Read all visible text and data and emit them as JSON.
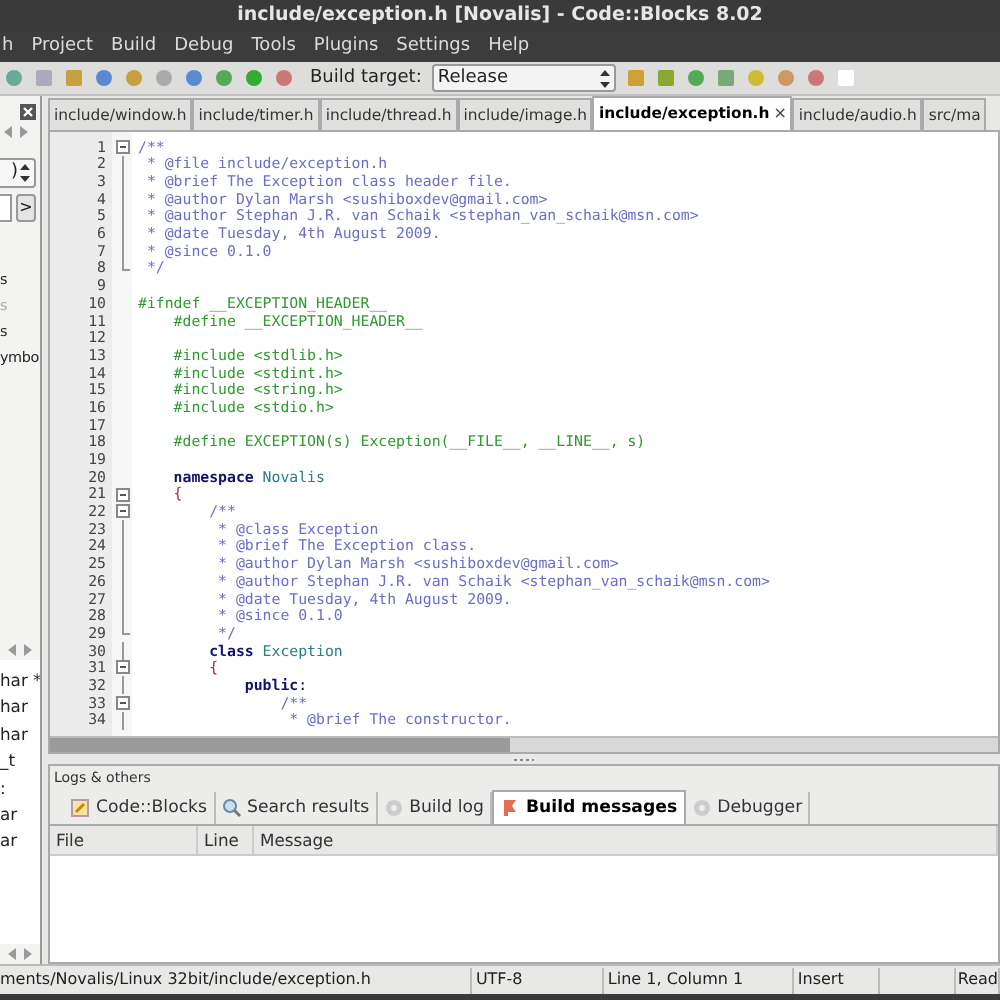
{
  "window": {
    "title": "include/exception.h [Novalis] - Code::Blocks 8.02"
  },
  "menu": [
    "h",
    "Project",
    "Build",
    "Debug",
    "Tools",
    "Plugins",
    "Settings",
    "Help"
  ],
  "toolbar": {
    "build_target_label": "Build target:",
    "build_target_value": "Release"
  },
  "left_panel": {
    "dropdown_value": ")",
    "go_button": ">",
    "items": [
      {
        "text": "s",
        "disabled": false
      },
      {
        "text": "s",
        "disabled": true
      },
      {
        "text": "s",
        "disabled": false
      },
      {
        "text": "ymbo",
        "disabled": false
      }
    ],
    "symbols": [
      "har *",
      "har",
      "har",
      "_t",
      ":",
      "ar",
      "ar"
    ]
  },
  "editor_tabs": [
    {
      "label": "include/window.h",
      "selected": false
    },
    {
      "label": "include/timer.h",
      "selected": false
    },
    {
      "label": "include/thread.h",
      "selected": false
    },
    {
      "label": "include/image.h",
      "selected": false
    },
    {
      "label": "include/exception.h",
      "selected": true,
      "close": "×"
    },
    {
      "label": "include/audio.h",
      "selected": false
    },
    {
      "label": "src/ma",
      "selected": false
    }
  ],
  "editor": {
    "lines": [
      {
        "number": "1",
        "kind": "fold-start",
        "expanded": true,
        "segments": [
          {
            "kind": "comment",
            "text": "/**"
          }
        ]
      },
      {
        "number": "2",
        "kind": "fold-middle",
        "segments": [
          {
            "kind": "comment",
            "text": " * @file include/exception.h"
          }
        ]
      },
      {
        "number": "3",
        "kind": "fold-middle",
        "segments": [
          {
            "kind": "comment",
            "text": " * @brief The Exception class header file."
          }
        ]
      },
      {
        "number": "4",
        "kind": "fold-middle",
        "segments": [
          {
            "kind": "comment",
            "text": " * @author Dylan Marsh <sushiboxdev@gmail.com>"
          }
        ]
      },
      {
        "number": "5",
        "kind": "fold-middle",
        "segments": [
          {
            "kind": "comment",
            "text": " * @author Stephan J.R. van Schaik <stephan_van_schaik@msn.com>"
          }
        ]
      },
      {
        "number": "6",
        "kind": "fold-middle",
        "segments": [
          {
            "kind": "comment",
            "text": " * @date Tuesday, 4th August 2009."
          }
        ]
      },
      {
        "number": "7",
        "kind": "fold-middle",
        "segments": [
          {
            "kind": "comment",
            "text": " * @since 0.1.0"
          }
        ]
      },
      {
        "number": "8",
        "kind": "fold-end",
        "segments": [
          {
            "kind": "comment",
            "text": " */"
          }
        ]
      },
      {
        "number": "9",
        "kind": "plain"
      },
      {
        "number": "10",
        "kind": "plain",
        "segments": [
          {
            "kind": "preprocessor",
            "text": "#ifndef __EXCEPTION_HEADER__"
          }
        ]
      },
      {
        "number": "11",
        "kind": "plain",
        "segments": [
          {
            "kind": "preprocessor",
            "text": "    #define __EXCEPTION_HEADER__"
          }
        ]
      },
      {
        "number": "12",
        "kind": "plain"
      },
      {
        "number": "13",
        "kind": "plain",
        "segments": [
          {
            "kind": "preprocessor",
            "text": "    #include <stdlib.h>"
          }
        ]
      },
      {
        "number": "14",
        "kind": "plain",
        "segments": [
          {
            "kind": "preprocessor",
            "text": "    #include <stdint.h>"
          }
        ]
      },
      {
        "number": "15",
        "kind": "plain",
        "segments": [
          {
            "kind": "preprocessor",
            "text": "    #include <string.h>"
          }
        ]
      },
      {
        "number": "16",
        "kind": "plain",
        "segments": [
          {
            "kind": "preprocessor",
            "text": "    #include <stdio.h>"
          }
        ]
      },
      {
        "number": "17",
        "kind": "plain"
      },
      {
        "number": "18",
        "kind": "plain",
        "segments": [
          {
            "kind": "preprocessor",
            "text": "    #define EXCEPTION(s) Exception(__FILE__, __LINE__, s)"
          }
        ]
      },
      {
        "number": "19",
        "kind": "plain"
      },
      {
        "number": "20",
        "kind": "plain",
        "segments": [
          {
            "kind": "keyword",
            "text": "    namespace"
          },
          {
            "kind": "identifier",
            "text": " Novalis"
          }
        ]
      },
      {
        "number": "21",
        "kind": "fold-start",
        "expanded": true,
        "segments": [
          {
            "kind": "brace",
            "text": "    {"
          }
        ]
      },
      {
        "number": "22",
        "kind": "fold-start",
        "expanded": true,
        "segments": [
          {
            "kind": "comment",
            "text": "        /**"
          }
        ]
      },
      {
        "number": "23",
        "kind": "fold-middle",
        "segments": [
          {
            "kind": "comment",
            "text": "         * @class Exception"
          }
        ]
      },
      {
        "number": "24",
        "kind": "fold-middle",
        "segments": [
          {
            "kind": "comment",
            "text": "         * @brief The Exception class."
          }
        ]
      },
      {
        "number": "25",
        "kind": "fold-middle",
        "segments": [
          {
            "kind": "comment",
            "text": "         * @author Dylan Marsh <sushiboxdev@gmail.com>"
          }
        ]
      },
      {
        "number": "26",
        "kind": "fold-middle",
        "segments": [
          {
            "kind": "comment",
            "text": "         * @author Stephan J.R. van Schaik <stephan_van_schaik@msn.com>"
          }
        ]
      },
      {
        "number": "27",
        "kind": "fold-middle",
        "segments": [
          {
            "kind": "comment",
            "text": "         * @date Tuesday, 4th August 2009."
          }
        ]
      },
      {
        "number": "28",
        "kind": "fold-middle",
        "segments": [
          {
            "kind": "comment",
            "text": "         * @since 0.1.0"
          }
        ]
      },
      {
        "number": "29",
        "kind": "fold-end",
        "segments": [
          {
            "kind": "comment",
            "text": "         */"
          }
        ]
      },
      {
        "number": "30",
        "kind": "fold-middle",
        "segments": [
          {
            "kind": "keyword",
            "text": "        class"
          },
          {
            "kind": "identifier",
            "text": " Exception"
          }
        ]
      },
      {
        "number": "31",
        "kind": "fold-start",
        "expanded": true,
        "segments": [
          {
            "kind": "brace",
            "text": "        {"
          }
        ]
      },
      {
        "number": "32",
        "kind": "fold-middle",
        "segments": [
          {
            "kind": "keyword",
            "text": "            public"
          },
          {
            "kind": "plain",
            "text": ":"
          }
        ]
      },
      {
        "number": "33",
        "kind": "fold-start",
        "expanded": true,
        "segments": [
          {
            "kind": "comment",
            "text": "                /**"
          }
        ]
      },
      {
        "number": "34",
        "kind": "fold-middle",
        "segments": [
          {
            "kind": "comment",
            "text": "                 * @brief The constructor."
          }
        ]
      }
    ]
  },
  "logs": {
    "title": "Logs & others",
    "tabs": [
      {
        "label": "Code::Blocks",
        "selected": false
      },
      {
        "label": "Search results",
        "selected": false
      },
      {
        "label": "Build log",
        "selected": false
      },
      {
        "label": "Build messages",
        "selected": true
      },
      {
        "label": "Debugger",
        "selected": false
      }
    ],
    "columns": [
      "File",
      "Line",
      "Message"
    ]
  },
  "status_bar": [
    "ments/Novalis/Linux 32bit/include/exception.h",
    "UTF-8",
    "Line 1, Column 1",
    "Insert",
    "Read"
  ]
}
